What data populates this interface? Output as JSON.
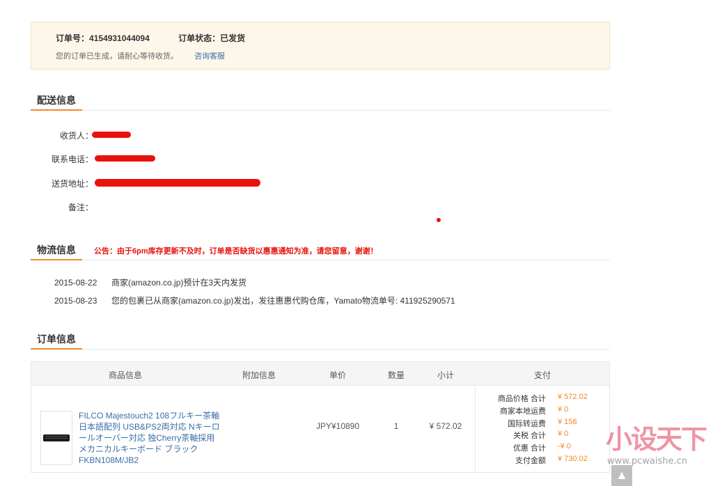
{
  "order": {
    "number_label": "订单号：",
    "number": "4154931044094",
    "status_label": "订单状态：",
    "status": "已发货",
    "message": "您的订单已生成，请耐心等待收货。",
    "consult_link": "咨询客服"
  },
  "delivery": {
    "title": "配送信息",
    "recipient_label": "收货人：",
    "phone_label": "联系电话：",
    "address_label": "送货地址：",
    "remark_label": "备注："
  },
  "logistics": {
    "title": "物流信息",
    "notice": "公告：由于6pm库存更新不及时，订单是否缺货以惠惠通知为准，请您留意，谢谢！",
    "entries": [
      {
        "date": "2015-08-22",
        "text": "商家(amazon.co.jp)预计在3天内发货"
      },
      {
        "date": "2015-08-23",
        "text": "您的包裹已从商家(amazon.co.jp)发出，发往惠惠代购仓库，Yamato物流单号: 411925290571"
      }
    ]
  },
  "order_info": {
    "title": "订单信息",
    "columns": [
      "商品信息",
      "附加信息",
      "单价",
      "数量",
      "小计",
      "支付"
    ],
    "item": {
      "name": "FILCO Majestouch2 108フルキー茶軸 日本語配列 USB&PS2両対応 Nキーロールオーバー対応 独Cherry茶軸採用 メカニカルキーボード ブラック FKBN108M/JB2",
      "unit_price": "JPY¥10890",
      "quantity": "1",
      "subtotal": "¥ 572.02"
    },
    "payment": [
      {
        "label": "商品价格 合计",
        "value": "¥ 572.02"
      },
      {
        "label": "商家本地运费",
        "value": "¥ 0"
      },
      {
        "label": "国际转运费",
        "value": "¥ 158"
      },
      {
        "label": "关税 合计",
        "value": "¥ 0"
      },
      {
        "label": "优惠 合计",
        "value": "-¥ 0"
      },
      {
        "label": "支付金额",
        "value": "¥ 730.02"
      }
    ]
  },
  "watermark": {
    "brand": "小设天下",
    "url": "www.pcwaishe.cn"
  },
  "scroll_top_icon": "arrow-up-icon",
  "colors": {
    "accent": "#f08a24",
    "notice": "#e8120c",
    "link": "#3a6ea5",
    "banner_bg": "#fdf7ea"
  }
}
